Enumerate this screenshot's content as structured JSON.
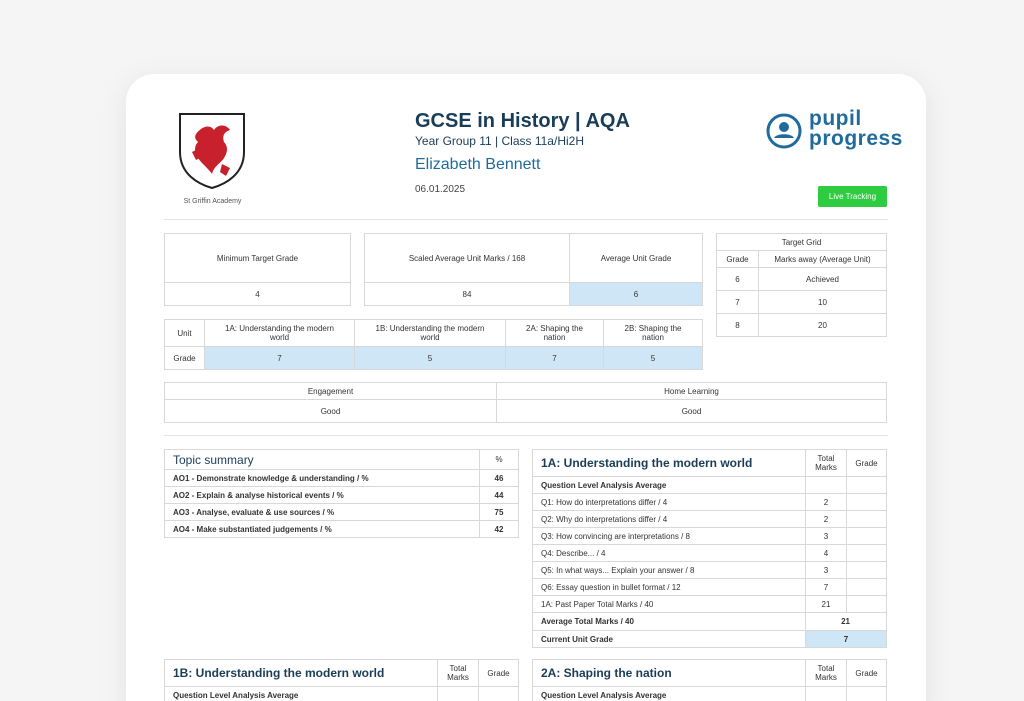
{
  "school": {
    "name": "St Griffin Academy",
    "logo_icon": "griffin-shield-icon"
  },
  "header": {
    "title": "GCSE in History | AQA",
    "subtitle": "Year Group 11 | Class 11a/Hi2H",
    "student_name": "Elizabeth Bennett",
    "date": "06.01.2025",
    "brand_line1": "pupil",
    "brand_line2": "progress",
    "brand_icon": "pupil-progress-logo-icon",
    "live_button": "Live Tracking"
  },
  "summary": {
    "min_target_label": "Minimum Target Grade",
    "min_target_value": "4",
    "scaled_label": "Scaled Average Unit Marks / 168",
    "scaled_value": "84",
    "avg_grade_label": "Average Unit Grade",
    "avg_grade_value": "6"
  },
  "target_grid": {
    "title": "Target Grid",
    "col_grade": "Grade",
    "col_marks": "Marks away (Average Unit)",
    "rows": [
      {
        "grade": "6",
        "marks": "Achieved"
      },
      {
        "grade": "7",
        "marks": "10"
      },
      {
        "grade": "8",
        "marks": "20"
      }
    ]
  },
  "units": {
    "unit_label": "Unit",
    "grade_label": "Grade",
    "names": [
      "1A: Understanding the modern world",
      "1B: Understanding the modern world",
      "2A: Shaping the nation",
      "2B: Shaping the nation"
    ],
    "grades": [
      "7",
      "5",
      "7",
      "5"
    ]
  },
  "engagement": {
    "engagement_label": "Engagement",
    "engagement_value": "Good",
    "home_label": "Home Learning",
    "home_value": "Good"
  },
  "topic_summary": {
    "title": "Topic summary",
    "pct_header": "%",
    "rows": [
      {
        "label": "AO1 - Demonstrate knowledge & understanding / %",
        "value": "46"
      },
      {
        "label": "AO2 - Explain & analyse historical events / %",
        "value": "44"
      },
      {
        "label": "AO3 - Analyse, evaluate & use sources / %",
        "value": "75"
      },
      {
        "label": "AO4 - Make substantiated judgements / %",
        "value": "42"
      }
    ]
  },
  "unit_1a": {
    "title": "1A: Understanding the modern world",
    "total_header": "Total Marks",
    "grade_header": "Grade",
    "qla_label": "Question Level Analysis Average",
    "questions": [
      {
        "label": "Q1: How do interpretations differ / 4",
        "mark": "2"
      },
      {
        "label": "Q2: Why do interpretations differ / 4",
        "mark": "2"
      },
      {
        "label": "Q3: How convincing are interpretations / 8",
        "mark": "3"
      },
      {
        "label": "Q4: Describe... / 4",
        "mark": "4"
      },
      {
        "label": "Q5: In what ways... Explain your answer / 8",
        "mark": "3"
      },
      {
        "label": "Q6: Essay question in bullet format / 12",
        "mark": "7"
      },
      {
        "label": "1A: Past Paper Total Marks / 40",
        "mark": "21"
      }
    ],
    "avg_total_label": "Average Total Marks / 40",
    "avg_total_value": "21",
    "current_grade_label": "Current Unit Grade",
    "current_grade_value": "7"
  },
  "unit_1b": {
    "title": "1B: Understanding the modern world",
    "total_header": "Total Marks",
    "grade_header": "Grade",
    "qla_label": "Question Level Analysis Average"
  },
  "unit_2a": {
    "title": "2A: Shaping the nation",
    "total_header": "Total Marks",
    "grade_header": "Grade",
    "qla_label": "Question Level Analysis Average"
  },
  "colors": {
    "accent": "#1f6c9c",
    "highlight": "#cfe6f7",
    "live_button": "#2ecc40",
    "shield_red": "#c8202c"
  }
}
